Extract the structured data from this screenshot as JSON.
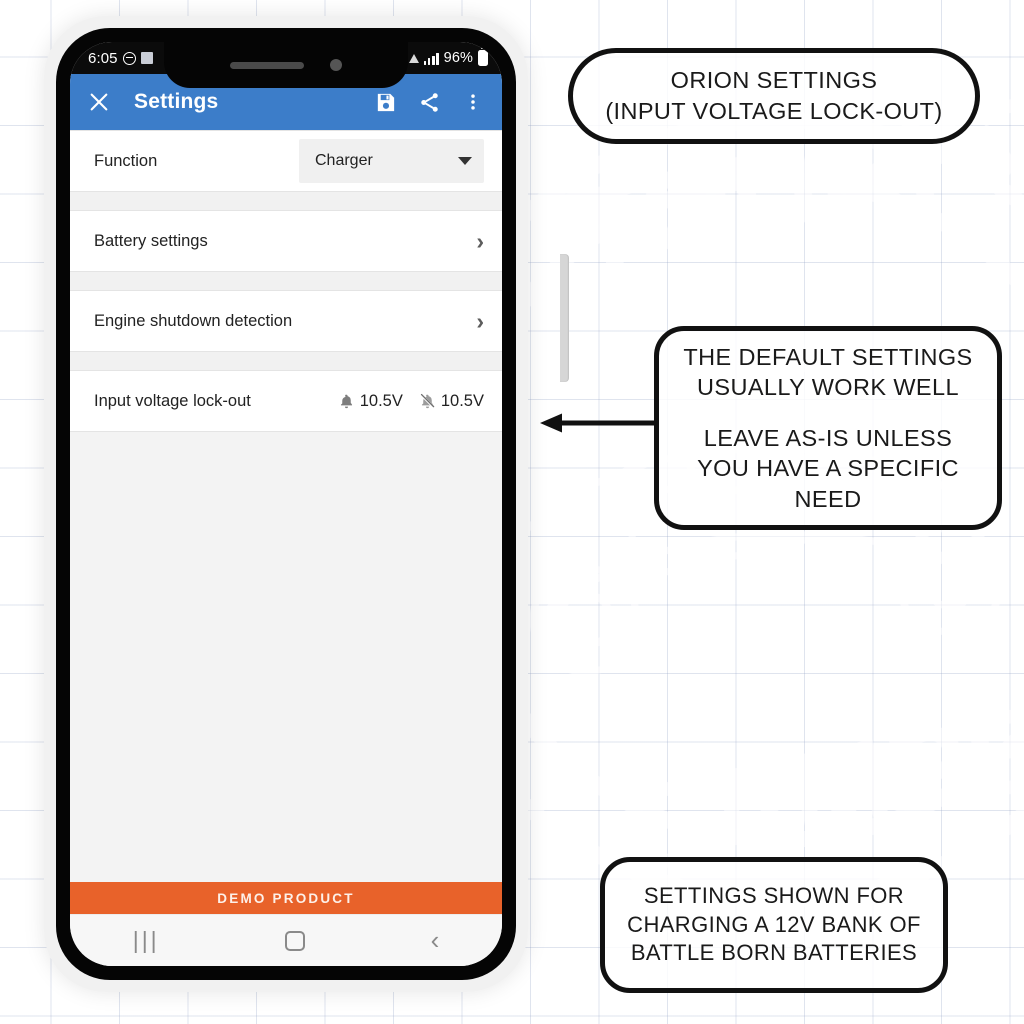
{
  "phone": {
    "status_bar": {
      "time": "6:05",
      "dnd_icon": "do-not-disturb-icon",
      "alarm_icon": "app-badge-icon",
      "wifi_icon": "wifi-icon",
      "signal_icon": "signal-bars-icon",
      "battery_percent": "96%",
      "battery_icon": "battery-icon"
    },
    "app_bar": {
      "close_icon": "close-icon",
      "title": "Settings",
      "save_icon": "save-icon",
      "share_icon": "share-icon",
      "overflow_icon": "overflow-menu-icon"
    },
    "settings_rows": [
      {
        "type": "dropdown",
        "label": "Function",
        "value": "Charger",
        "caret_icon": "chevron-down-icon"
      },
      {
        "type": "nav",
        "label": "Battery settings",
        "chevron": "›"
      },
      {
        "type": "nav",
        "label": "Engine shutdown detection",
        "chevron": "›"
      },
      {
        "type": "values",
        "label": "Input voltage lock-out",
        "values": [
          {
            "icon": "bell-on-icon",
            "text": "10.5V"
          },
          {
            "icon": "bell-off-icon",
            "text": "10.5V"
          }
        ]
      }
    ],
    "demo_banner": "DEMO PRODUCT",
    "nav_bar": {
      "recents_icon": "recents-icon",
      "recents_glyph": "|||",
      "home_icon": "home-icon",
      "back_icon": "back-icon",
      "back_glyph": "‹"
    },
    "hardware": {
      "mute_button": "mute-switch",
      "volume_up_button": "volume-up-button",
      "volume_down_button": "volume-down-button",
      "power_button": "power-button",
      "earpiece": "earpiece-speaker",
      "front_camera": "front-camera"
    }
  },
  "annotations": {
    "title_callout": {
      "line1": "ORION SETTINGS",
      "line2": "(INPUT VOLTAGE LOCK-OUT)"
    },
    "default_callout": {
      "line1": "THE DEFAULT SETTINGS",
      "line2": "USUALLY WORK WELL",
      "line3": "LEAVE AS-IS UNLESS",
      "line4": "YOU HAVE A SPECIFIC",
      "line5": "NEED"
    },
    "bottom_callout": {
      "line1": "SETTINGS SHOWN FOR",
      "line2": "CHARGING A 12V BANK OF",
      "line3": "BATTLE BORN BATTERIES"
    },
    "arrow_icon": "left-arrow-icon"
  },
  "colors": {
    "app_bar_blue": "#3c7dc9",
    "demo_orange": "#e8622a",
    "grid_line": "#96a5c8",
    "status_bar_black": "#0b0b0b"
  }
}
